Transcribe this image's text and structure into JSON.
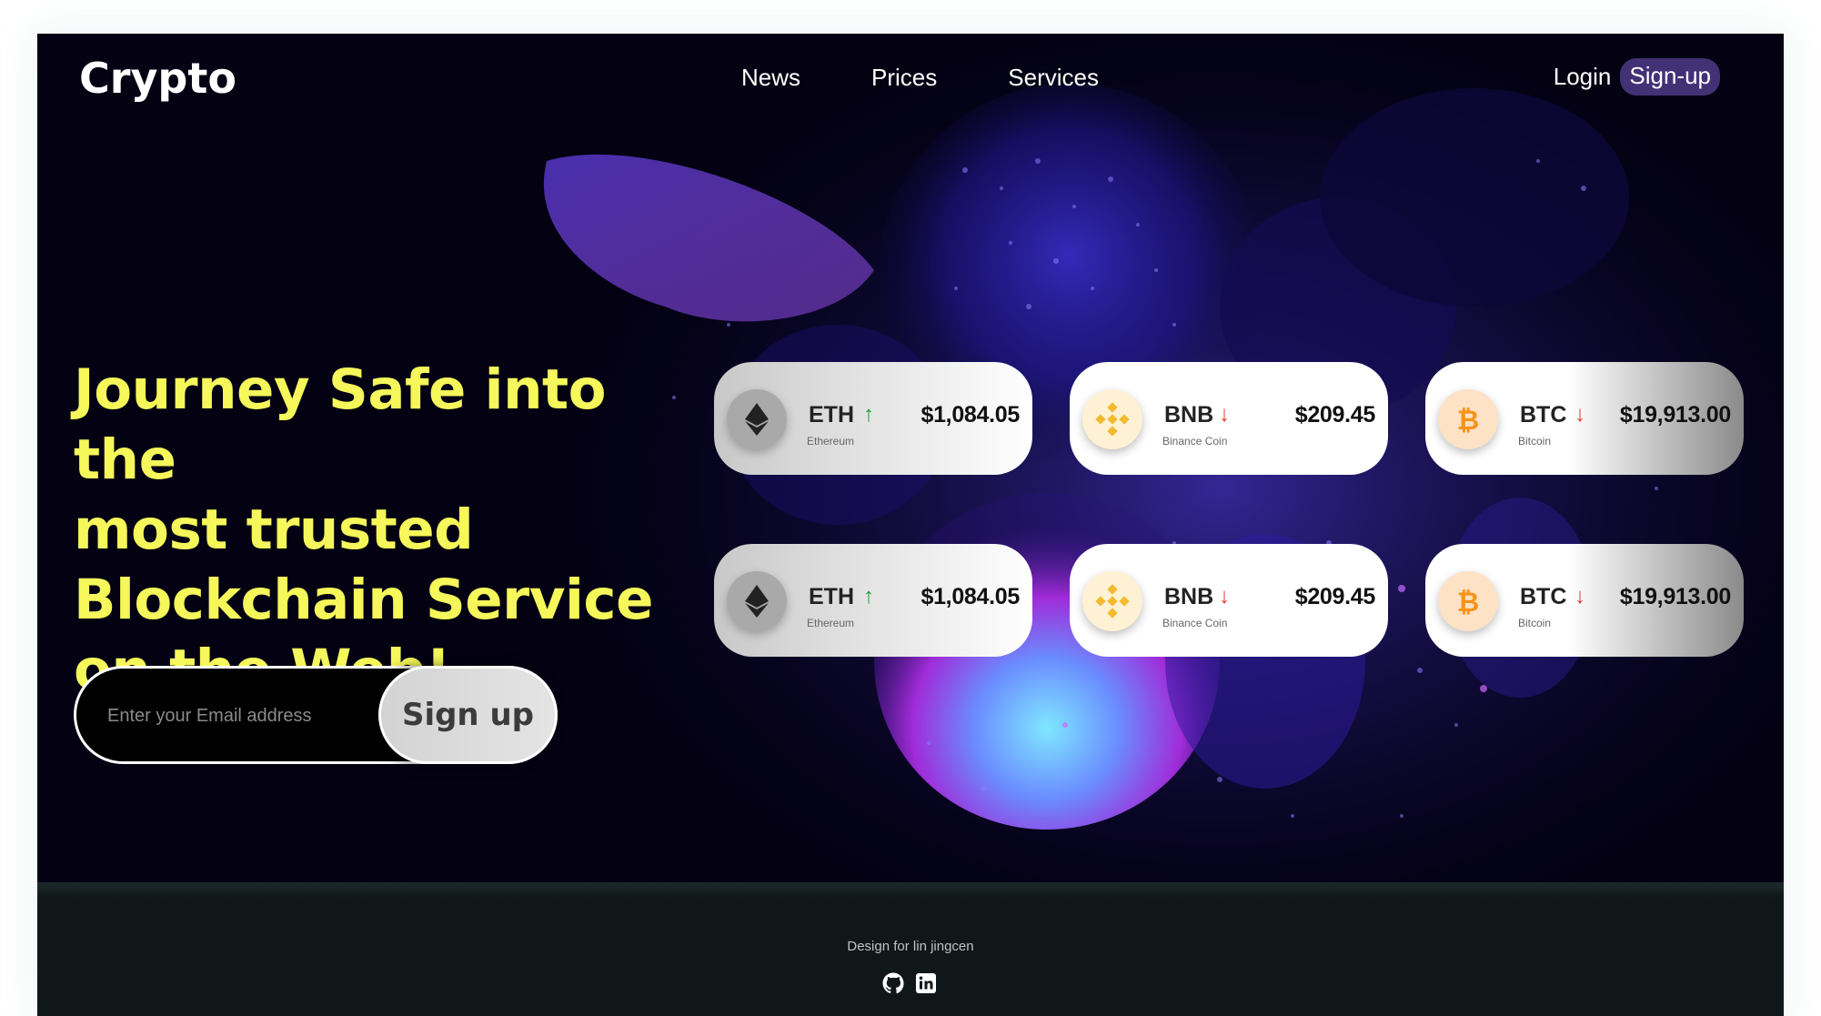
{
  "header": {
    "logo": "Crypto",
    "nav": [
      {
        "label": "News"
      },
      {
        "label": "Prices"
      },
      {
        "label": "Services"
      }
    ],
    "login_label": "Login",
    "signup_label": "Sign-up"
  },
  "hero": {
    "headline_lines": [
      "Journey Safe into the",
      "most trusted",
      "Blockchain Service",
      "on the Web!"
    ],
    "email_placeholder": "Enter your Email address",
    "signup_button": "Sign up"
  },
  "coins": [
    {
      "symbol": "ETH",
      "name": "Ethereum",
      "price": "$1,084.05",
      "trend": "up",
      "arrow": "↑",
      "icon": "ethereum-icon"
    },
    {
      "symbol": "BNB",
      "name": "Binance Coin",
      "price": "$209.45",
      "trend": "down",
      "arrow": "↓",
      "icon": "binance-icon"
    },
    {
      "symbol": "BTC",
      "name": "Bitcoin",
      "price": "$19,913.00",
      "trend": "down",
      "arrow": "↓",
      "icon": "bitcoin-icon"
    },
    {
      "symbol": "ETH",
      "name": "Ethereum",
      "price": "$1,084.05",
      "trend": "up",
      "arrow": "↑",
      "icon": "ethereum-icon"
    },
    {
      "symbol": "BNB",
      "name": "Binance Coin",
      "price": "$209.45",
      "trend": "down",
      "arrow": "↓",
      "icon": "binance-icon"
    },
    {
      "symbol": "BTC",
      "name": "Bitcoin",
      "price": "$19,913.00",
      "trend": "down",
      "arrow": "↓",
      "icon": "bitcoin-icon"
    }
  ],
  "footer": {
    "credit": "Design for lin jingcen",
    "social_icons": [
      "github-icon",
      "linkedin-icon"
    ]
  },
  "colors": {
    "headline": "#f5f75a",
    "up": "#19a33a",
    "down": "#e23b2b",
    "bnb": "#f3ba2f",
    "btc": "#f7931a",
    "footer_bg": "#0f1718"
  }
}
